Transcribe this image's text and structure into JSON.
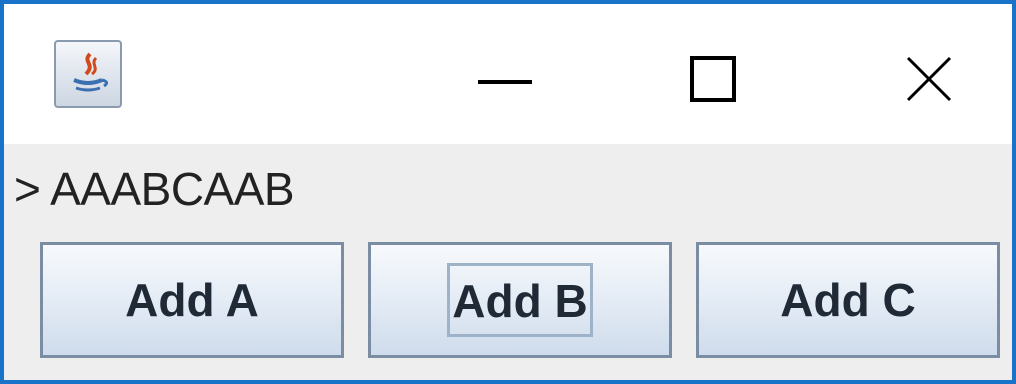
{
  "window": {
    "icon": "java-app-icon",
    "controls": {
      "minimize": "minimize-icon",
      "maximize": "maximize-icon",
      "close": "close-icon"
    },
    "accent_color": "#1a73c8"
  },
  "output": {
    "text": "> AAABCAAB"
  },
  "buttons": {
    "add_a": "Add A",
    "add_b": "Add B",
    "add_c": "Add C"
  }
}
